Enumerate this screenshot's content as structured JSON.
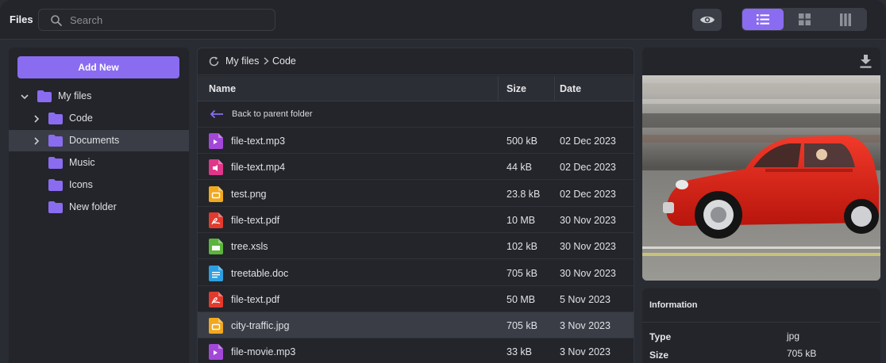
{
  "app": {
    "title": "Files"
  },
  "search": {
    "placeholder": "Search",
    "value": ""
  },
  "toolbar": {
    "preview_icon": "eye-icon",
    "views": [
      {
        "name": "list-view",
        "icon": "list-icon",
        "active": true
      },
      {
        "name": "grid-view",
        "icon": "grid-icon",
        "active": false
      },
      {
        "name": "columns-view",
        "icon": "columns-icon",
        "active": false
      }
    ],
    "accent": "#8a6cf0"
  },
  "sidebar": {
    "add_new_label": "Add New",
    "tree": [
      {
        "label": "My files",
        "expanded": true
      },
      {
        "label": "Code",
        "expanded": false
      },
      {
        "label": "Documents",
        "expanded": false,
        "selected": true
      },
      {
        "label": "Music"
      },
      {
        "label": "Icons"
      },
      {
        "label": "New folder"
      }
    ]
  },
  "breadcrumb": {
    "items": [
      "My files",
      "Code"
    ]
  },
  "table": {
    "headers": {
      "name": "Name",
      "size": "Size",
      "date": "Date"
    },
    "back_label": "Back to parent folder",
    "rows": [
      {
        "name": "file-text.mp3",
        "size": "500 kB",
        "date": "02 Dec 2023",
        "icon": "audio-file-icon"
      },
      {
        "name": "file-text.mp4",
        "size": "44 kB",
        "date": "02 Dec 2023",
        "icon": "video-file-icon"
      },
      {
        "name": "test.png",
        "size": "23.8 kB",
        "date": "02 Dec 2023",
        "icon": "image-file-icon"
      },
      {
        "name": "file-text.pdf",
        "size": "10 MB",
        "date": "30 Nov 2023",
        "icon": "pdf-file-icon"
      },
      {
        "name": "tree.xsls",
        "size": "102 kB",
        "date": "30 Nov 2023",
        "icon": "spreadsheet-file-icon"
      },
      {
        "name": "treetable.doc",
        "size": "705 kB",
        "date": "30 Nov 2023",
        "icon": "document-file-icon"
      },
      {
        "name": "file-text.pdf",
        "size": "50 MB",
        "date": "5 Nov 2023",
        "icon": "pdf-file-icon"
      },
      {
        "name": "city-traffic.jpg",
        "size": "705 kB",
        "date": "3 Nov 2023",
        "icon": "image-file-icon",
        "selected": true
      },
      {
        "name": "file-movie.mp3",
        "size": "33 kB",
        "date": "3 Nov 2023",
        "icon": "audio-file-icon"
      }
    ]
  },
  "preview": {
    "download_icon": "download-icon",
    "image": "red-convertible-car-photo"
  },
  "info": {
    "title": "Information",
    "fields": [
      {
        "key": "Type",
        "value": "jpg"
      },
      {
        "key": "Size",
        "value": "705 kB"
      }
    ]
  }
}
